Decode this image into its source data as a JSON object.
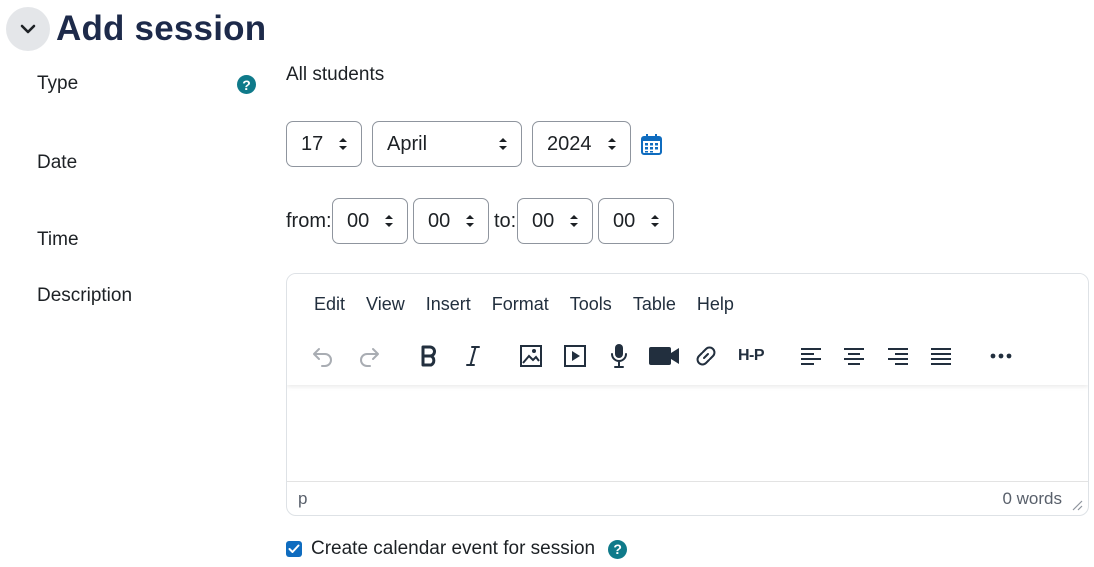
{
  "header": {
    "title": "Add session",
    "collapse_icon": "chevron-down-icon"
  },
  "type": {
    "label": "Type",
    "value": "All students",
    "help_icon": "question-circle-icon",
    "help_glyph": "?"
  },
  "date": {
    "label": "Date",
    "day": "17",
    "month": "April",
    "year": "2024",
    "calendar_icon": "calendar-icon"
  },
  "time": {
    "label": "Time",
    "from_label": "from:",
    "to_label": "to:",
    "from_hour": "00",
    "from_minute": "00",
    "to_hour": "00",
    "to_minute": "00"
  },
  "description": {
    "label": "Description",
    "menu": [
      "Edit",
      "View",
      "Insert",
      "Format",
      "Tools",
      "Table",
      "Help"
    ],
    "toolbar": [
      "undo-icon",
      "redo-icon",
      "bold-icon",
      "italic-icon",
      "image-icon",
      "media-icon",
      "microphone-icon",
      "video-camera-icon",
      "link-icon",
      "h5p-icon",
      "align-left-icon",
      "align-center-icon",
      "align-right-icon",
      "align-justify-icon",
      "more-icon"
    ],
    "h5p_text": "H-P",
    "status_path": "p",
    "word_count": "0 words"
  },
  "calendar_event": {
    "label": "Create calendar event for session",
    "checked": true,
    "help_glyph": "?"
  },
  "colors": {
    "title": "#1d2a4a",
    "help": "#0f7a8a",
    "checkbox": "#0f6cbf",
    "calendar": "#0f6cbf"
  }
}
